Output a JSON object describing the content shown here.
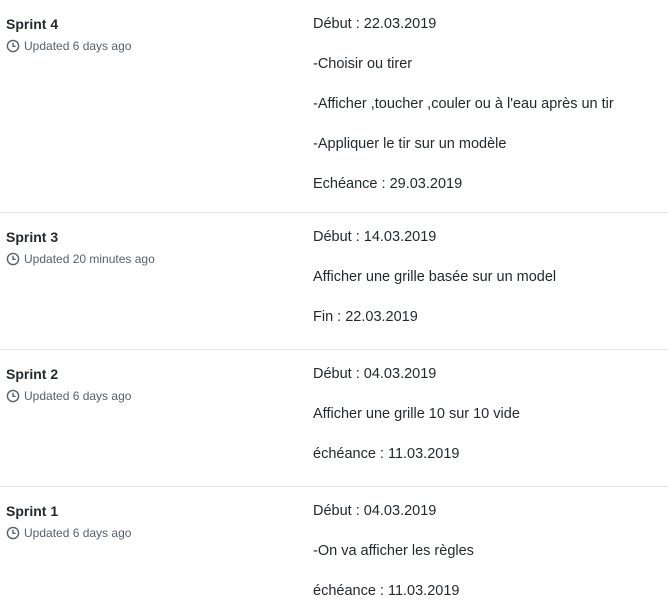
{
  "milestones": [
    {
      "title": "Sprint 4",
      "updated": "Updated 6 days ago",
      "lines": [
        "Début : 22.03.2019",
        "-Choisir ou tirer",
        "-Afficher ,toucher ,couler ou à l'eau après un tir",
        "-Appliquer le tir sur un modèle",
        "Echéance : 29.03.2019"
      ]
    },
    {
      "title": "Sprint 3",
      "updated": "Updated 20 minutes ago",
      "lines": [
        "Début : 14.03.2019",
        "Afficher une grille basée sur un model",
        "Fin : 22.03.2019"
      ]
    },
    {
      "title": "Sprint 2",
      "updated": "Updated 6 days ago",
      "lines": [
        "Début : 04.03.2019",
        "Afficher une grille 10 sur 10 vide",
        "échéance : 11.03.2019"
      ]
    },
    {
      "title": "Sprint 1",
      "updated": "Updated 6 days ago",
      "lines": [
        "Début : 04.03.2019",
        "-On va afficher les règles",
        "échéance : 11.03.2019"
      ]
    }
  ],
  "icons": {
    "updated": "clock-icon"
  },
  "colors": {
    "text": "#24292e",
    "muted": "#586069",
    "divider": "#e1e4e8"
  }
}
